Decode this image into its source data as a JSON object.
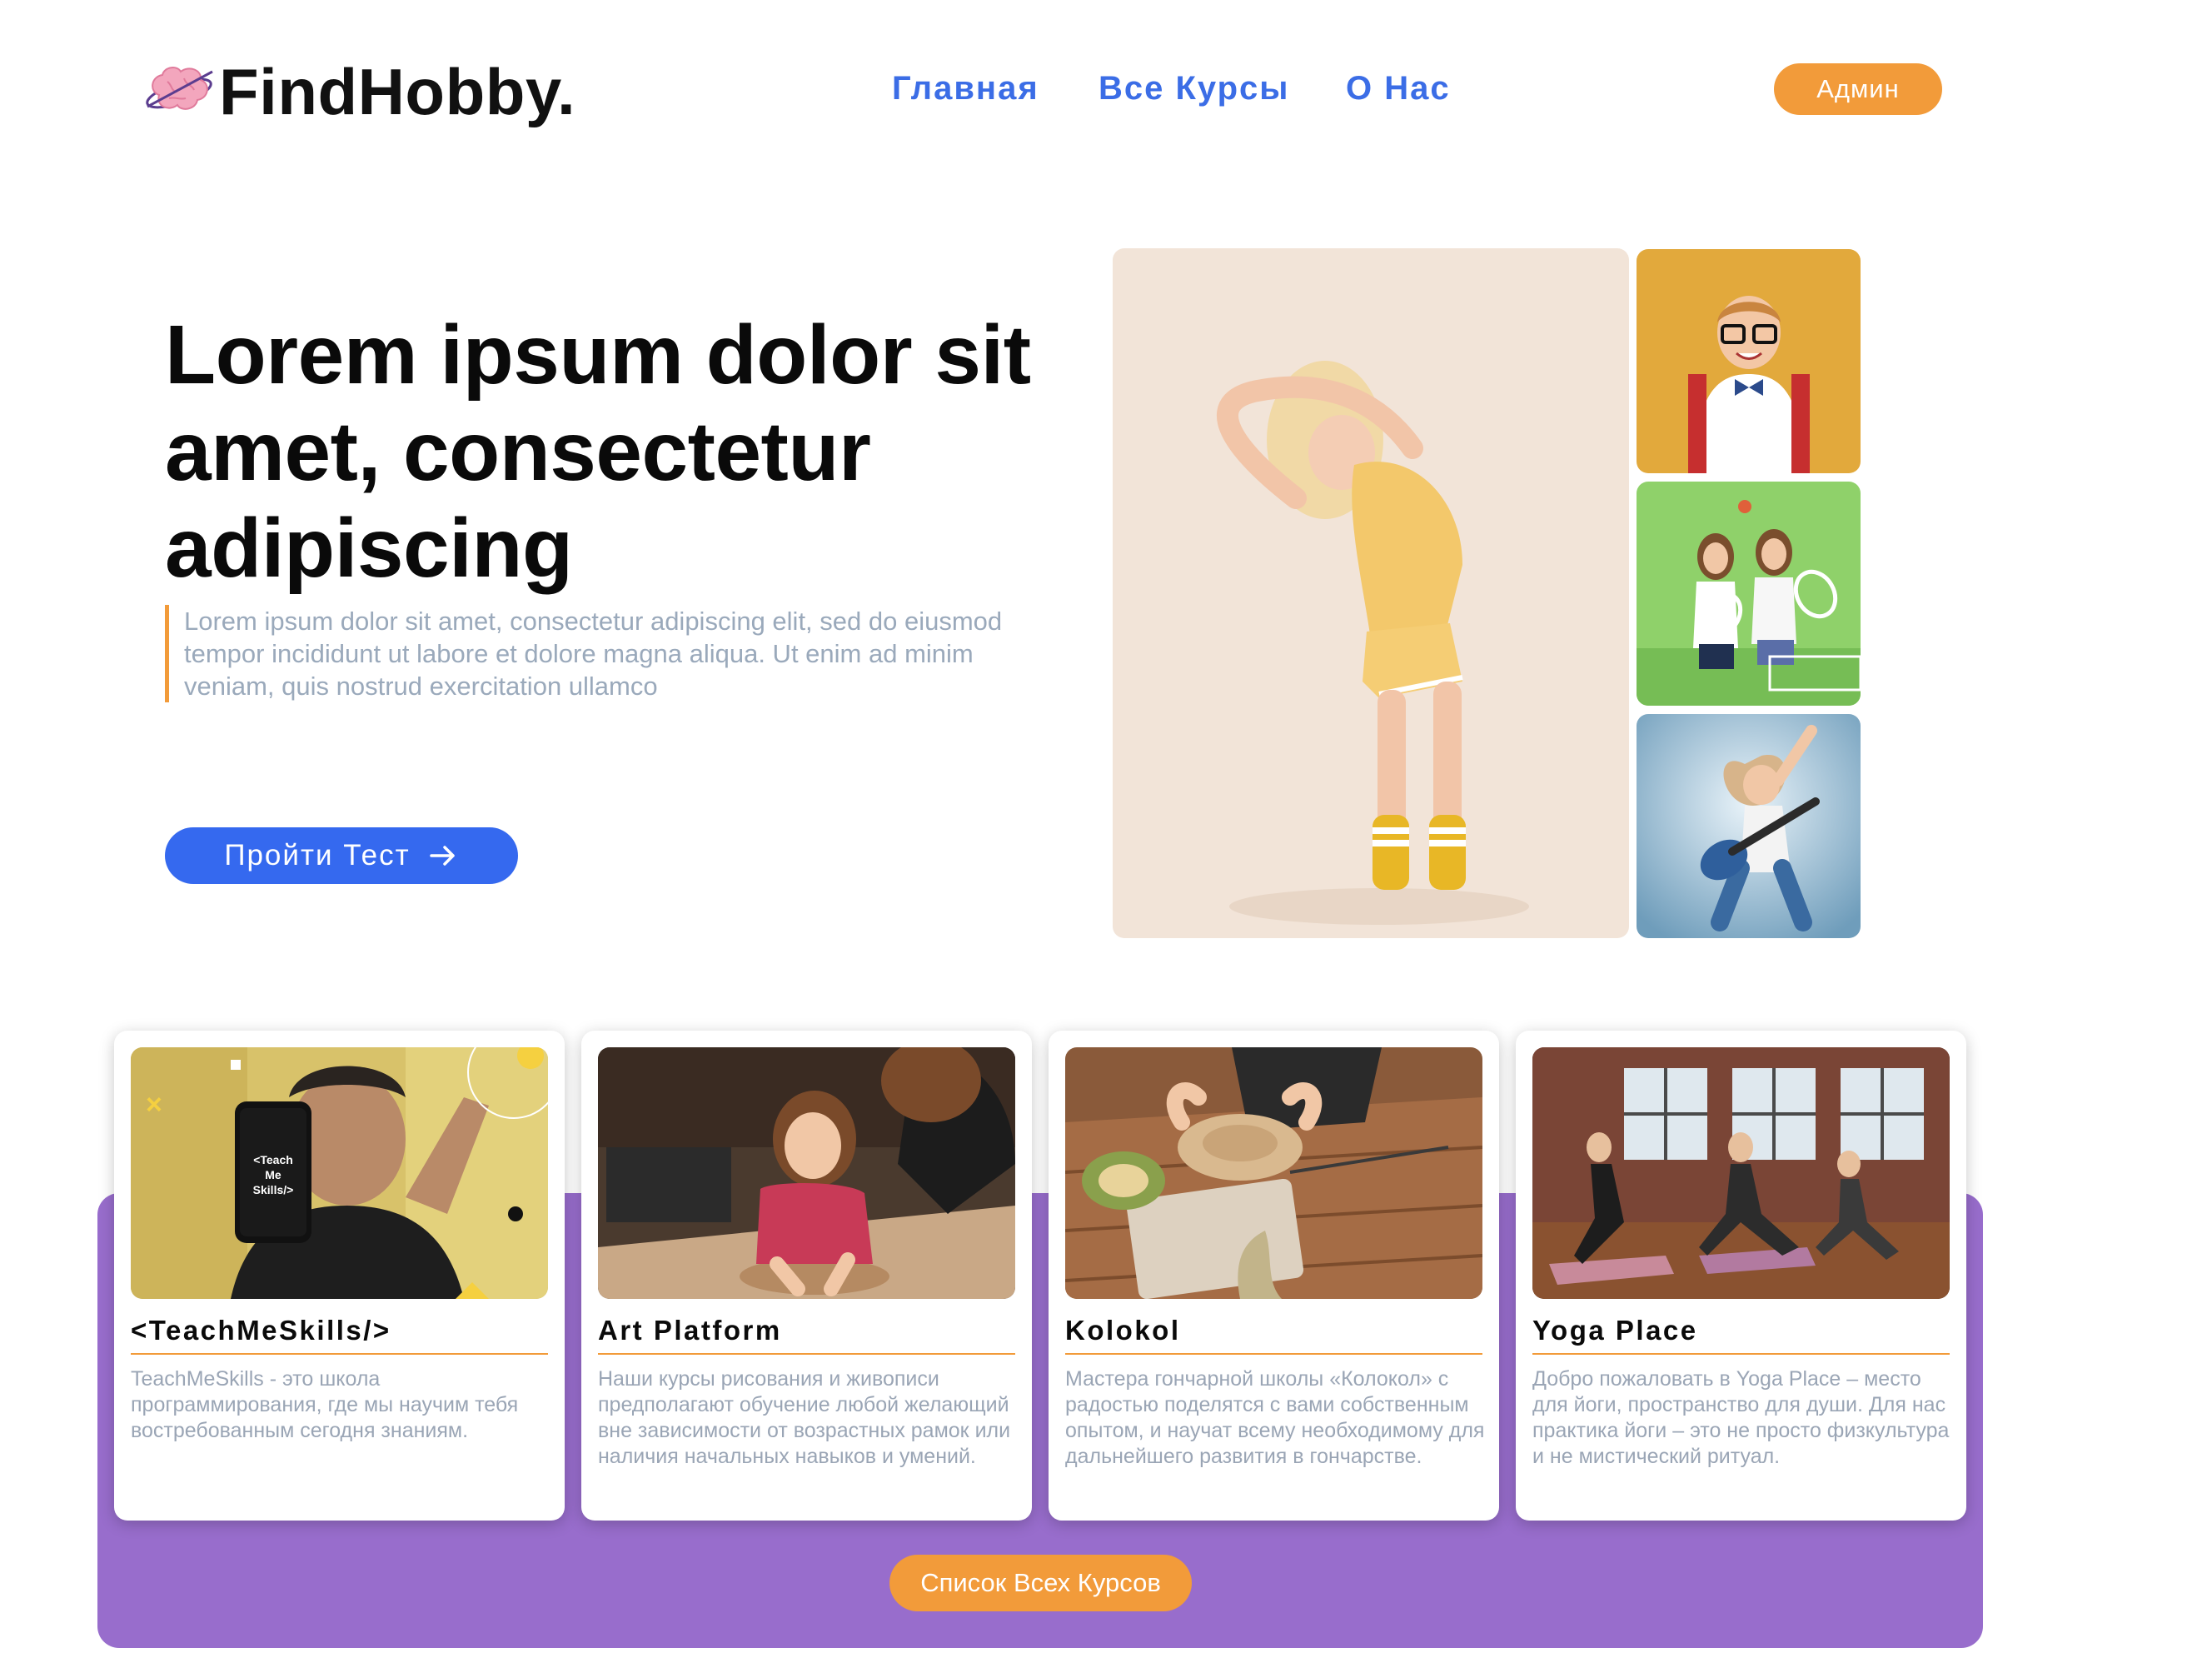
{
  "brand": {
    "name": "FindHobby.",
    "logo_icon": "pink-brain-planet-icon"
  },
  "nav": {
    "items": [
      "Главная",
      "Все Курсы",
      "О Нас"
    ],
    "admin_label": "Админ"
  },
  "hero": {
    "title": "Lorem ipsum dolor sit amet, consectetur adipiscing",
    "text": "Lorem ipsum dolor sit amet, consectetur adipiscing elit, sed do eiusmod tempor incididunt ut labore et dolore magna aliqua. Ut enim ad minim veniam, quis nostrud exercitation ullamco",
    "cta_label": "Пройти Тест",
    "cta_icon": "arrow-right-icon",
    "photos": [
      "girl-stretching-photo",
      "schoolboy-with-glasses-photo",
      "girls-playing-tennis-photo",
      "girl-with-guitar-photo"
    ]
  },
  "courses": {
    "cards": [
      {
        "title": "<TeachMeSkills/>",
        "description": "TeachMeSkills - это школа программирования, где мы научим тебя востребованным сегодня знаниям.",
        "image": "man-holding-phone-photo",
        "phone_text": "<Teach Me Skills/>"
      },
      {
        "title": "Art Platform",
        "description": "Наши курсы рисования и живописи предполагают обучение любой желающий вне зависимости от возрастных рамок или наличия начальных навыков и умений.",
        "image": "child-sculpting-clay-photo"
      },
      {
        "title": "Kolokol",
        "description": "Мастера гончарной школы «Колокол» с радостью поделятся с вами собственным опытом, и научат всему необходимому для дальнейшего развития в гончарстве.",
        "image": "pottery-workshop-photo"
      },
      {
        "title": "Yoga Place",
        "description": "Добро пожаловать в Yoga Place – место для йоги, пространство для души. Для нас практика йоги – это не просто физкультура и не мистический ритуал.",
        "image": "yoga-class-photo"
      }
    ],
    "all_courses_label": "Список Всех Курсов"
  },
  "colors": {
    "accent_orange": "#f29b3a",
    "primary_blue": "#3569ef",
    "nav_blue": "#3b6de6",
    "purple_band": "#986dcc",
    "muted_text": "#9aa9bb"
  }
}
